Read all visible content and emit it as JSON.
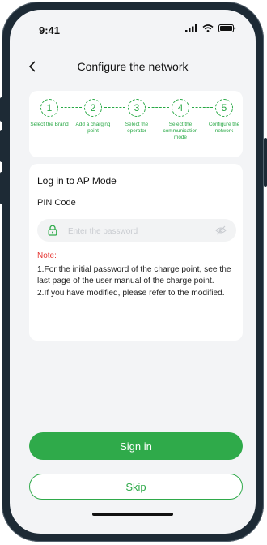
{
  "status_bar": {
    "time": "9:41",
    "icons": [
      "signal-icon",
      "wifi-icon",
      "battery-icon"
    ]
  },
  "header": {
    "back_icon": "chevron-left-icon",
    "title": "Configure the network"
  },
  "steps": [
    {
      "number": "1",
      "label": "Select the Brand"
    },
    {
      "number": "2",
      "label": "Add a charging point"
    },
    {
      "number": "3",
      "label": "Select the operator"
    },
    {
      "number": "4",
      "label": "Select the communication mode"
    },
    {
      "number": "5",
      "label": "Configure the network"
    }
  ],
  "form": {
    "title": "Log in to AP Mode",
    "pin_label": "PIN Code",
    "password": {
      "value": "",
      "placeholder": "Enter the password",
      "lock_icon": "lock-icon",
      "eye_icon": "eye-off-icon"
    },
    "note_title": "Note:",
    "note_1": "1.For the initial password of the charge point, see the last page of the user manual of the charge point.",
    "note_2": "2.If you have modified, please refer to the modified."
  },
  "buttons": {
    "sign_in": "Sign in",
    "skip": "Skip"
  },
  "colors": {
    "accent": "#2faa4a",
    "note": "#e53935",
    "background": "#f3f4f6"
  }
}
